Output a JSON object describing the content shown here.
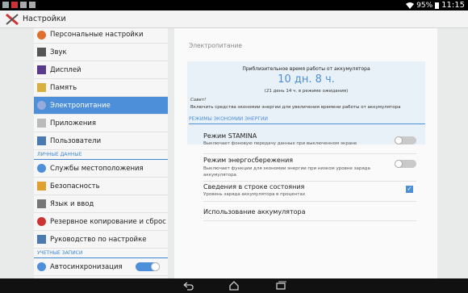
{
  "status_bar": {
    "battery": "95%",
    "time": "11:15"
  },
  "action_bar": {
    "title": "Настройки"
  },
  "sidebar": {
    "items": [
      {
        "label": "Персональные настройки",
        "icon": "personalize-icon"
      },
      {
        "label": "Звук",
        "icon": "sound-icon"
      },
      {
        "label": "Дисплей",
        "icon": "display-icon"
      },
      {
        "label": "Память",
        "icon": "memory-icon"
      },
      {
        "label": "Электропитание",
        "icon": "power-icon",
        "selected": true
      },
      {
        "label": "Приложения",
        "icon": "apps-icon"
      },
      {
        "label": "Пользователи",
        "icon": "users-icon"
      }
    ],
    "section_personal": "ЛИЧНЫЕ ДАННЫЕ",
    "personal_items": [
      {
        "label": "Службы местоположения",
        "icon": "location-icon"
      },
      {
        "label": "Безопасность",
        "icon": "lock-icon"
      },
      {
        "label": "Язык и ввод",
        "icon": "keyboard-icon"
      },
      {
        "label": "Резервное копирование и сброс",
        "icon": "backup-icon"
      },
      {
        "label": "Руководство по настройке",
        "icon": "guide-icon"
      }
    ],
    "section_accounts": "УЧЕТНЫЕ ЗАПИСИ",
    "autosync_label": "Автосинхронизация"
  },
  "main": {
    "header": "Электропитание",
    "info": {
      "title": "Приблизительное время работы от аккумулятора",
      "value": "10 дн. 8 ч.",
      "standby": "(21 день 14 ч. в режиме ожидания)",
      "tip_label": "Совет!",
      "tip_text": "Включить средства экономии энергии для увеличения времени работы от аккумулятора"
    },
    "section": "РЕЖИМЫ ЭКОНОМИИ ЭНЕРГИИ",
    "rows": [
      {
        "title": "Режим STAMINA",
        "subtitle": "Выключает фоновую передачу данных при выключенном экране"
      },
      {
        "title": "Режим энергосбережения",
        "subtitle": "Выключает функции для экономии энергии при низком уровне заряда аккумулятора"
      },
      {
        "title": "Сведения в строке состояния",
        "subtitle": "Уровень заряда аккумулятора в процентах"
      },
      {
        "title": "Использование аккумулятора",
        "subtitle": ""
      }
    ]
  },
  "colors": {
    "accent": "#4d8fd9",
    "statusbar": "#000000",
    "navbar": "#111111"
  }
}
